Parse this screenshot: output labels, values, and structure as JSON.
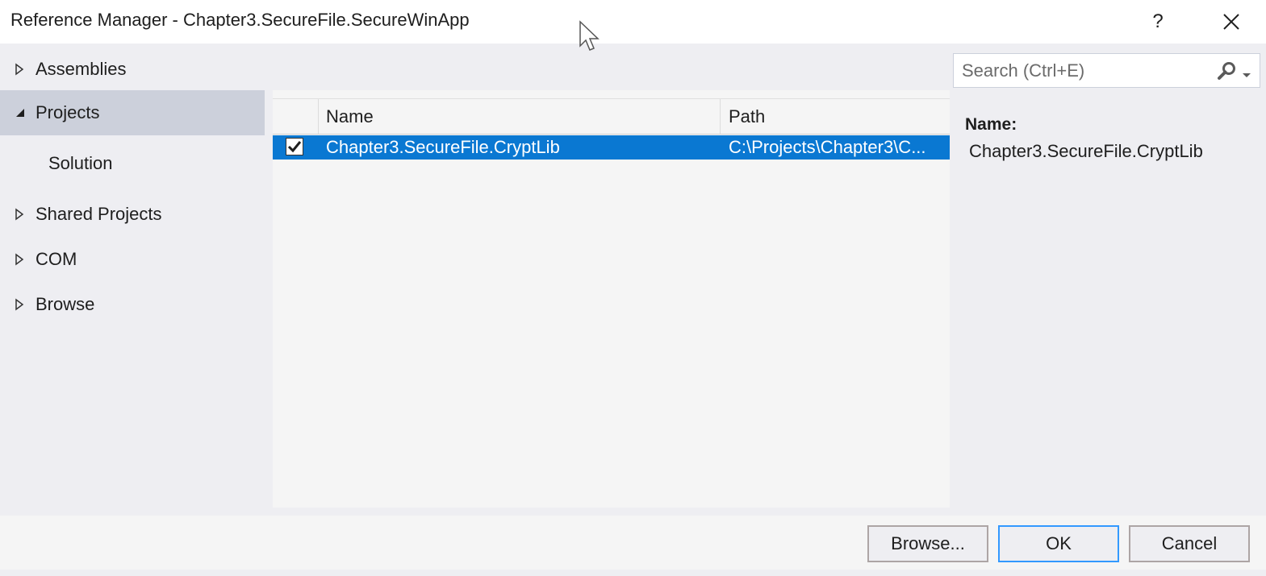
{
  "window": {
    "title": "Reference Manager - Chapter3.SecureFile.SecureWinApp",
    "help_label": "?",
    "close_label": "✕"
  },
  "sidebar": {
    "items": [
      {
        "label": "Assemblies",
        "expanded": false
      },
      {
        "label": "Projects",
        "expanded": true,
        "selected": true
      },
      {
        "label": "Solution",
        "sub": true
      },
      {
        "label": "Shared Projects",
        "expanded": false
      },
      {
        "label": "COM",
        "expanded": false
      },
      {
        "label": "Browse",
        "expanded": false
      }
    ]
  },
  "list": {
    "columns": {
      "name": "Name",
      "path": "Path"
    },
    "rows": [
      {
        "checked": true,
        "name": "Chapter3.SecureFile.CryptLib",
        "path": "C:\\Projects\\Chapter3\\C..."
      }
    ]
  },
  "search": {
    "placeholder": "Search (Ctrl+E)",
    "value": ""
  },
  "details": {
    "label": "Name:",
    "value": "Chapter3.SecureFile.CryptLib"
  },
  "footer": {
    "browse_label": "Browse...",
    "ok_label": "OK",
    "cancel_label": "Cancel"
  },
  "colors": {
    "selection": "#0a78d2",
    "sidebar_selected": "#ccd0db",
    "background": "#eeeef2",
    "primary_border": "#3399ff"
  }
}
